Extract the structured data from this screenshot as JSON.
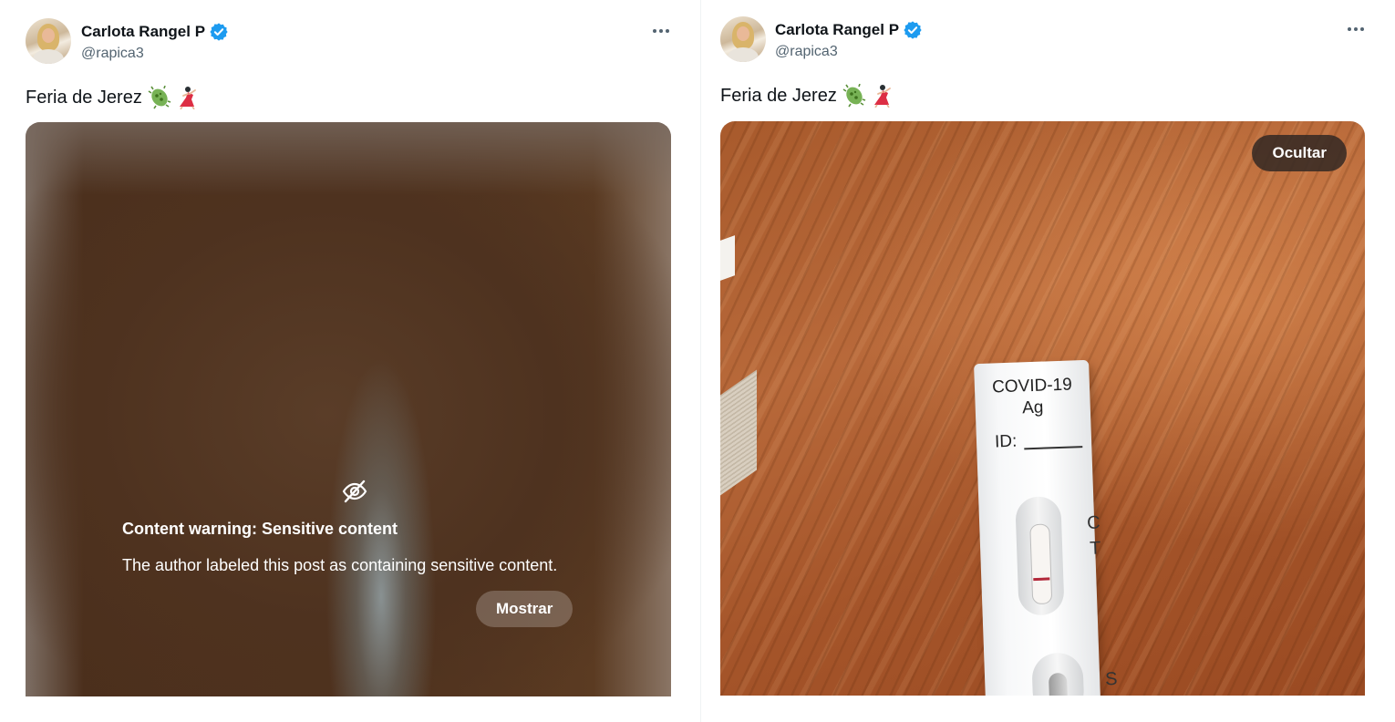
{
  "posts": [
    {
      "author": {
        "name": "Carlota Rangel P",
        "handle": "@rapica3",
        "verified": true
      },
      "text": "Feria de Jerez",
      "emojis": [
        "microbe-emoji",
        "dancer-emoji"
      ],
      "more_icon": "more-horizontal-icon",
      "media": {
        "state": "hidden",
        "icon": "eye-slash-icon",
        "warning_title": "Content warning: Sensitive content",
        "warning_body": "The author labeled this post as containing sensitive content.",
        "button_label": "Mostrar"
      }
    },
    {
      "author": {
        "name": "Carlota Rangel P",
        "handle": "@rapica3",
        "verified": true
      },
      "text": "Feria de Jerez",
      "emojis": [
        "microbe-emoji",
        "dancer-emoji"
      ],
      "more_icon": "more-horizontal-icon",
      "media": {
        "state": "shown",
        "button_label": "Ocultar",
        "test_text": {
          "name": "COVID-19",
          "sub": "Ag",
          "id_label": "ID:",
          "c": "C",
          "t": "T",
          "s": "S"
        }
      }
    }
  ],
  "colors": {
    "verified": "#1d9bf0",
    "text": "#0f1419",
    "secondary": "#536471",
    "test_line": "#b2283a"
  }
}
